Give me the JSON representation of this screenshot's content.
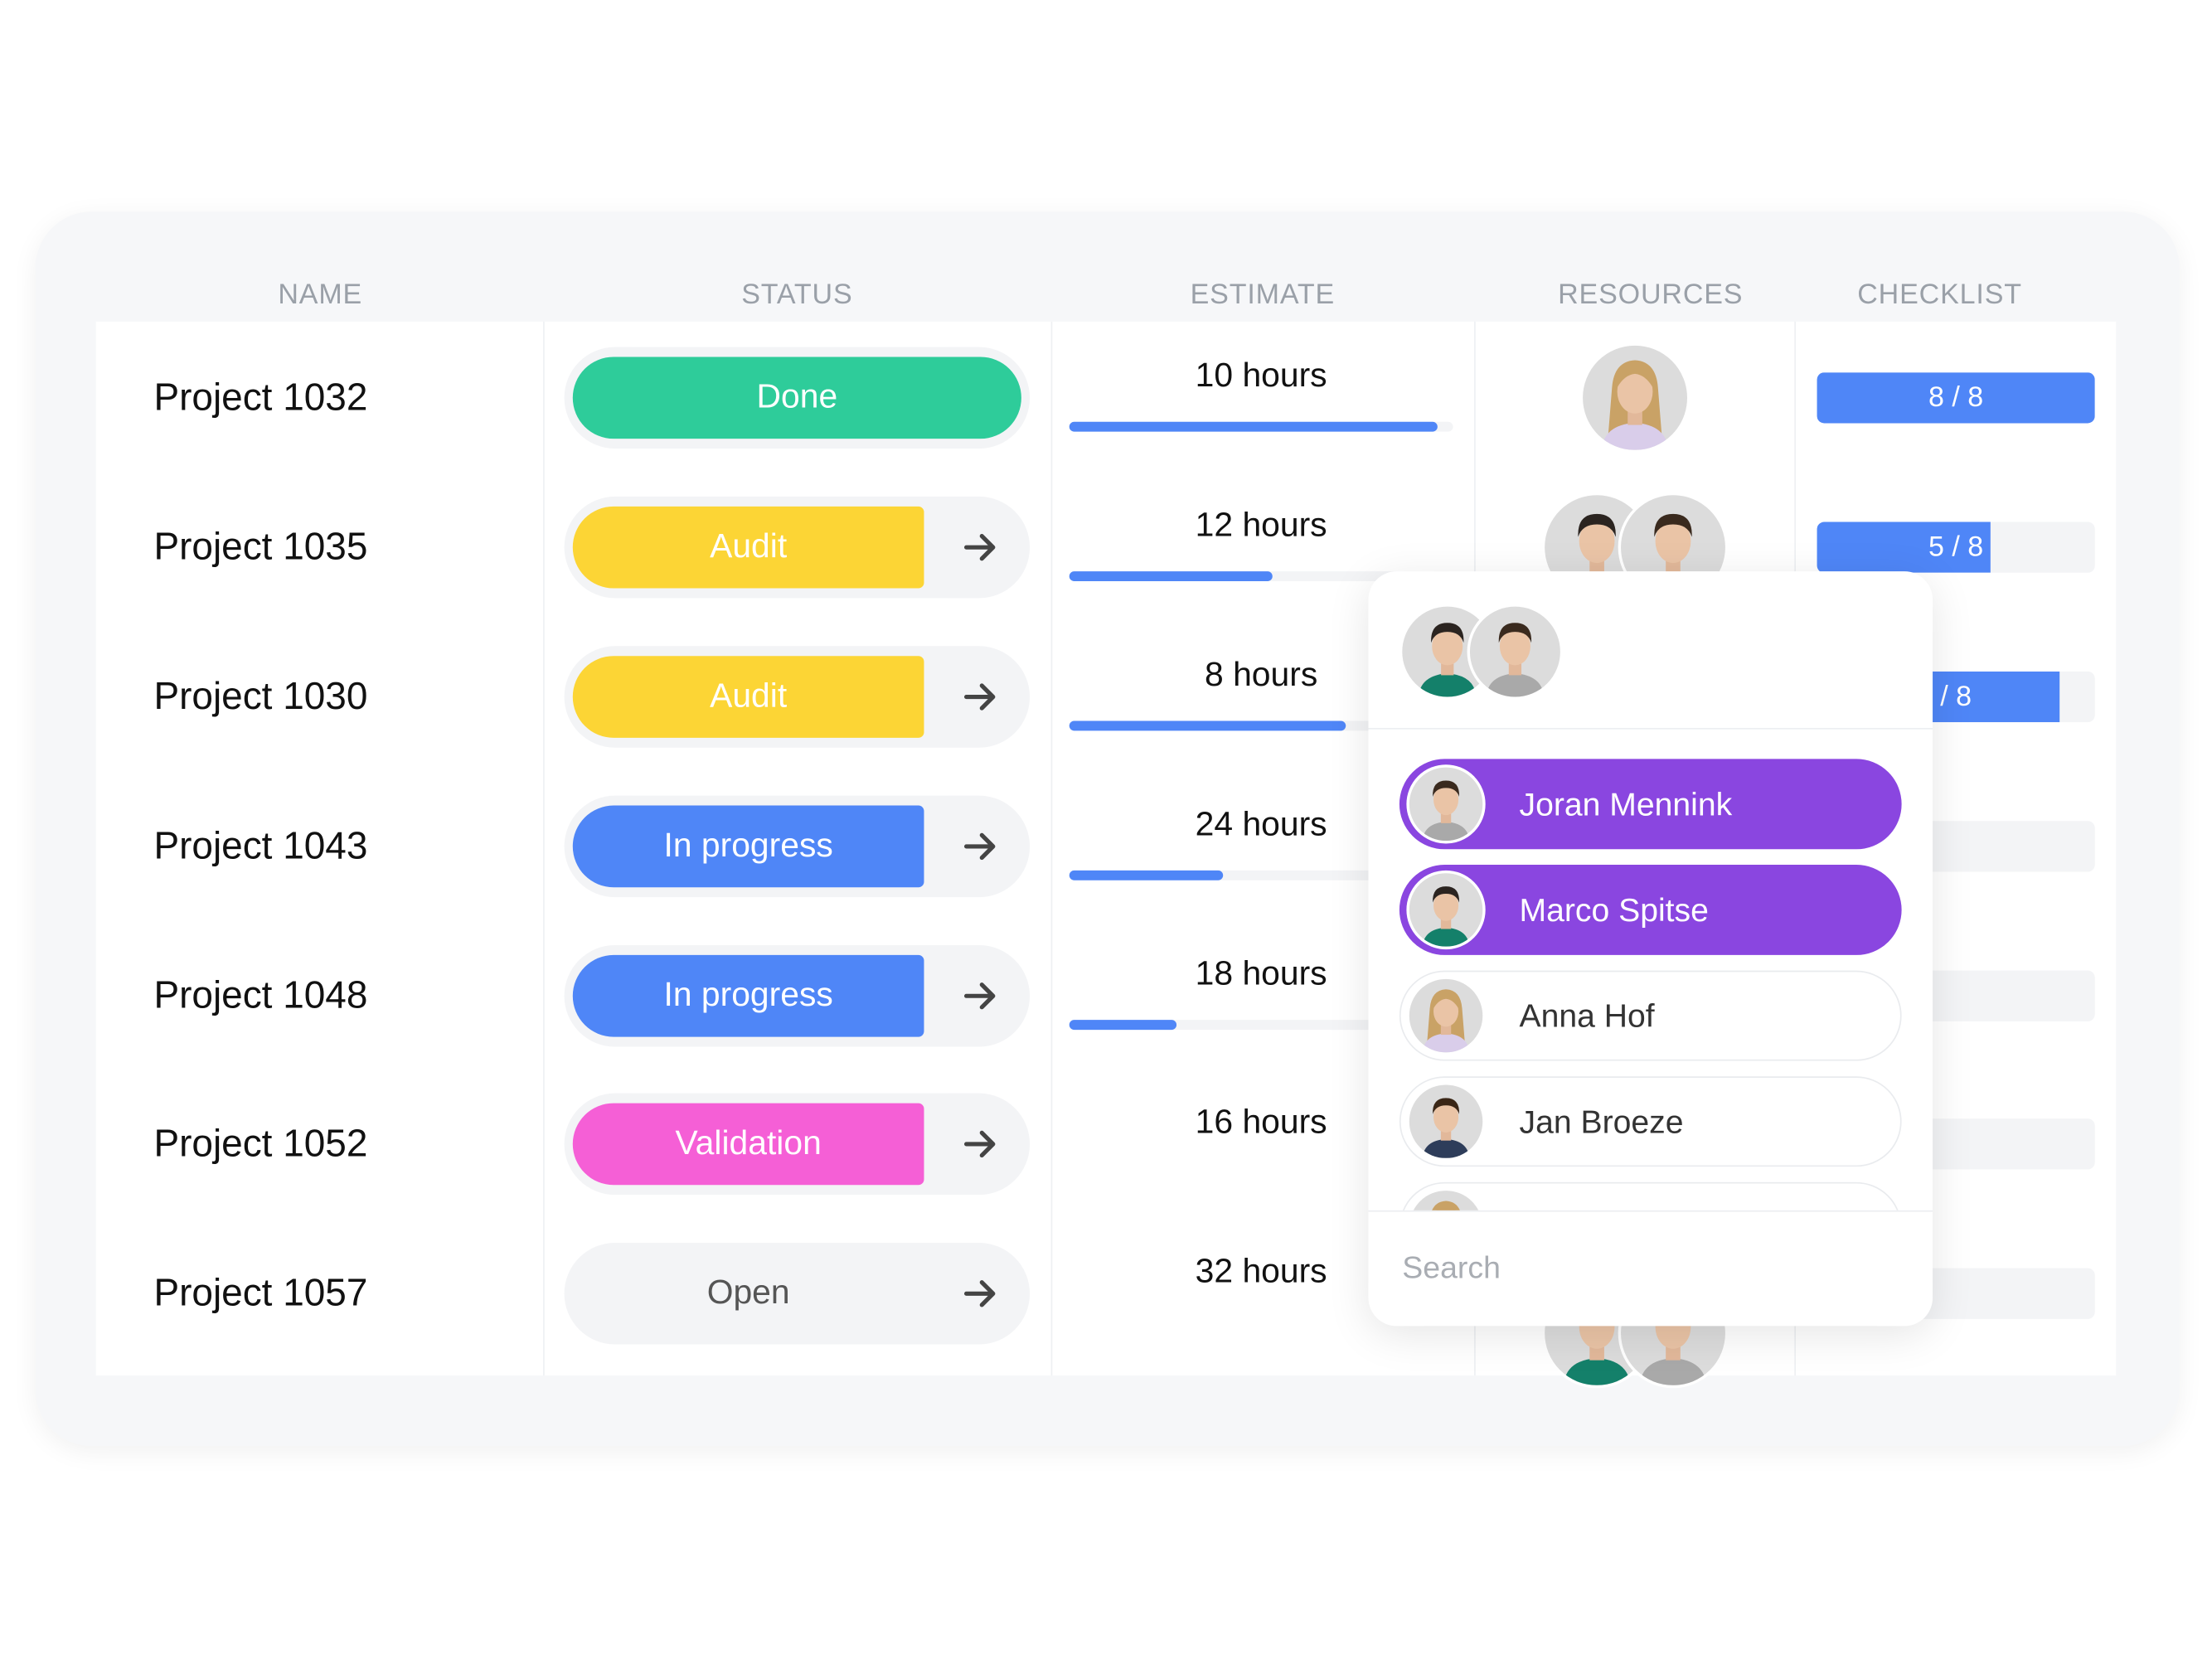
{
  "columns": {
    "name": "NAME",
    "status": "STATUS",
    "estimate": "ESTIMATE",
    "resources": "RESOURCES",
    "checklist": "CHECKLIST"
  },
  "colors": {
    "done": "#2ecc9a",
    "audit": "#fcd535",
    "in_progress": "#4f86f7",
    "validation": "#f55fd6",
    "open": "transparent",
    "progress": "#4f86f7",
    "selected": "#8a46e0"
  },
  "rows": [
    {
      "name": "Project 1032",
      "status": "Done",
      "status_key": "done",
      "has_arrow": false,
      "estimate": "10 hours",
      "estimate_progress": 0.96,
      "resources": [
        "woman-blonde"
      ],
      "checklist": "8 / 8",
      "checklist_progress": 1.0
    },
    {
      "name": "Project 1035",
      "status": "Audit",
      "status_key": "audit",
      "has_arrow": true,
      "estimate": "12 hours",
      "estimate_progress": 0.53,
      "resources": [
        "man-green-shirt",
        "man-grey-shirt"
      ],
      "checklist": "5 / 8",
      "checklist_progress": 0.625
    },
    {
      "name": "Project 1030",
      "status": "Audit",
      "status_key": "audit",
      "has_arrow": true,
      "estimate": "8 hours",
      "estimate_progress": 0.72,
      "resources": [],
      "checklist": "/ 8",
      "checklist_progress": 0.875
    },
    {
      "name": "Project 1043",
      "status": "In progress",
      "status_key": "in_progress",
      "has_arrow": true,
      "estimate": "24 hours",
      "estimate_progress": 0.4,
      "resources": [],
      "checklist": "",
      "checklist_progress": 0
    },
    {
      "name": "Project 1048",
      "status": "In progress",
      "status_key": "in_progress",
      "has_arrow": true,
      "estimate": "18 hours",
      "estimate_progress": 0.28,
      "resources": [],
      "checklist": "",
      "checklist_progress": 0
    },
    {
      "name": "Project 1052",
      "status": "Validation",
      "status_key": "validation",
      "has_arrow": true,
      "estimate": "16 hours",
      "estimate_progress": null,
      "resources": [],
      "checklist": "",
      "checklist_progress": 0
    },
    {
      "name": "Project 1057",
      "status": "Open",
      "status_key": "open",
      "has_arrow": true,
      "estimate": "32 hours",
      "estimate_progress": null,
      "resources": [
        "man-green-shirt",
        "man-grey-shirt"
      ],
      "checklist": "",
      "checklist_progress": 0
    }
  ],
  "popup": {
    "selected_avatars": [
      "man-green-shirt",
      "man-grey-shirt"
    ],
    "people": [
      {
        "name": "Joran Mennink",
        "avatar": "man-grey-shirt",
        "selected": true
      },
      {
        "name": "Marco Spitse",
        "avatar": "man-green-shirt",
        "selected": true
      },
      {
        "name": "Anna Hof",
        "avatar": "woman-blonde",
        "selected": false
      },
      {
        "name": "Jan Broeze",
        "avatar": "man-navy-shirt",
        "selected": false
      },
      {
        "name": "",
        "avatar": "woman-blonde",
        "selected": false
      }
    ],
    "search_placeholder": "Search"
  }
}
